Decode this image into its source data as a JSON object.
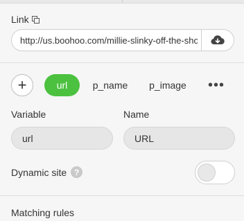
{
  "link": {
    "label": "Link",
    "url_value": "http://us.boohoo.com/millie-slinky-off-the-shoulder-dress",
    "icons": {
      "copy": "copy-icon",
      "cloud": "cloud-download-icon"
    }
  },
  "variables": {
    "add_label": "+",
    "tabs": [
      {
        "label": "url",
        "active": true
      },
      {
        "label": "p_name",
        "active": false
      },
      {
        "label": "p_image",
        "active": false
      }
    ],
    "more_label": "•••",
    "active_color": "#4cc140"
  },
  "fields": {
    "variable_label": "Variable",
    "variable_value": "url",
    "name_label": "Name",
    "name_value": "URL"
  },
  "dynamic_site": {
    "label": "Dynamic site",
    "help_label": "?",
    "enabled": false
  },
  "matching_rules": {
    "label": "Matching rules"
  }
}
